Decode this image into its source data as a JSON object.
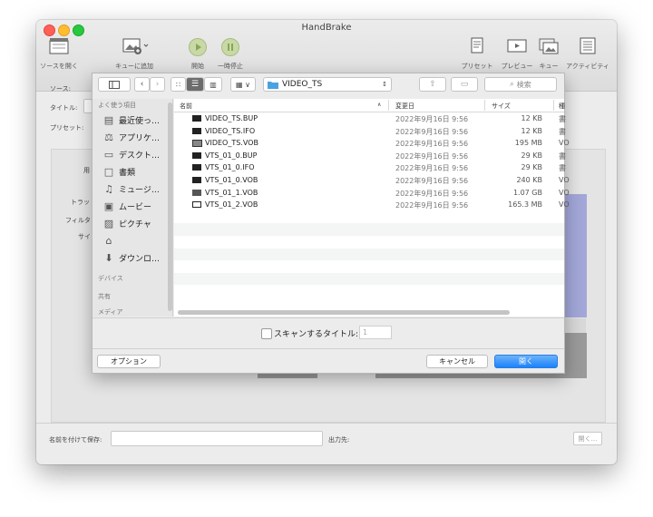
{
  "window": {
    "title": "HandBrake"
  },
  "toolbar": {
    "open_source": "ソースを開く",
    "add_queue": "キューに追加",
    "start": "開始",
    "pause": "一時停止",
    "presets": "プリセット",
    "preview": "プレビュー",
    "queue": "キュー",
    "activity": "アクティビティ"
  },
  "background": {
    "source_label": "ソース:",
    "title_label": "タイトル:",
    "preset_label": "プリセット:",
    "side_labels": [
      "用",
      "トラッ",
      "フィルタ",
      "サイ"
    ],
    "save_as_label": "名前を付けて保存:",
    "output_label": "出力先:",
    "open_button": "開く..."
  },
  "dialog": {
    "folder": "VIDEO_TS",
    "search_placeholder": "検索",
    "sidebar": {
      "favorites_header": "よく使う項目",
      "favorites": [
        {
          "label": "最近使っ…",
          "icon": "recents-icon"
        },
        {
          "label": "アプリケ…",
          "icon": "applications-icon"
        },
        {
          "label": "デスクト…",
          "icon": "desktop-icon"
        },
        {
          "label": "書類",
          "icon": "documents-icon"
        },
        {
          "label": "ミュージ…",
          "icon": "music-icon"
        },
        {
          "label": "ムービー",
          "icon": "movies-icon"
        },
        {
          "label": "ピクチャ",
          "icon": "pictures-icon"
        },
        {
          "label": "",
          "icon": "home-icon"
        },
        {
          "label": "ダウンロ…",
          "icon": "downloads-icon"
        }
      ],
      "devices_header": "デバイス",
      "shared_header": "共有",
      "media_header": "メディア"
    },
    "columns": {
      "name": "名前",
      "modified": "変更日",
      "size": "サイズ",
      "kind": "種"
    },
    "files": [
      {
        "name": "VIDEO_TS.BUP",
        "date": "2022年9月16日 9:56",
        "size": "12 KB",
        "kind": "書"
      },
      {
        "name": "VIDEO_TS.IFO",
        "date": "2022年9月16日 9:56",
        "size": "12 KB",
        "kind": "書"
      },
      {
        "name": "VIDEO_TS.VOB",
        "date": "2022年9月16日 9:56",
        "size": "195 MB",
        "kind": "VO"
      },
      {
        "name": "VTS_01_0.BUP",
        "date": "2022年9月16日 9:56",
        "size": "29 KB",
        "kind": "書"
      },
      {
        "name": "VTS_01_0.IFO",
        "date": "2022年9月16日 9:56",
        "size": "29 KB",
        "kind": "書"
      },
      {
        "name": "VTS_01_0.VOB",
        "date": "2022年9月16日 9:56",
        "size": "240 KB",
        "kind": "VO"
      },
      {
        "name": "VTS_01_1.VOB",
        "date": "2022年9月16日 9:56",
        "size": "1.07 GB",
        "kind": "VO"
      },
      {
        "name": "VTS_01_2.VOB",
        "date": "2022年9月16日 9:56",
        "size": "165.3 MB",
        "kind": "VO"
      }
    ],
    "scan_label": "スキャンするタイトル:",
    "scan_value": "1",
    "options_button": "オプション",
    "cancel_button": "キャンセル",
    "open_button": "開く"
  }
}
